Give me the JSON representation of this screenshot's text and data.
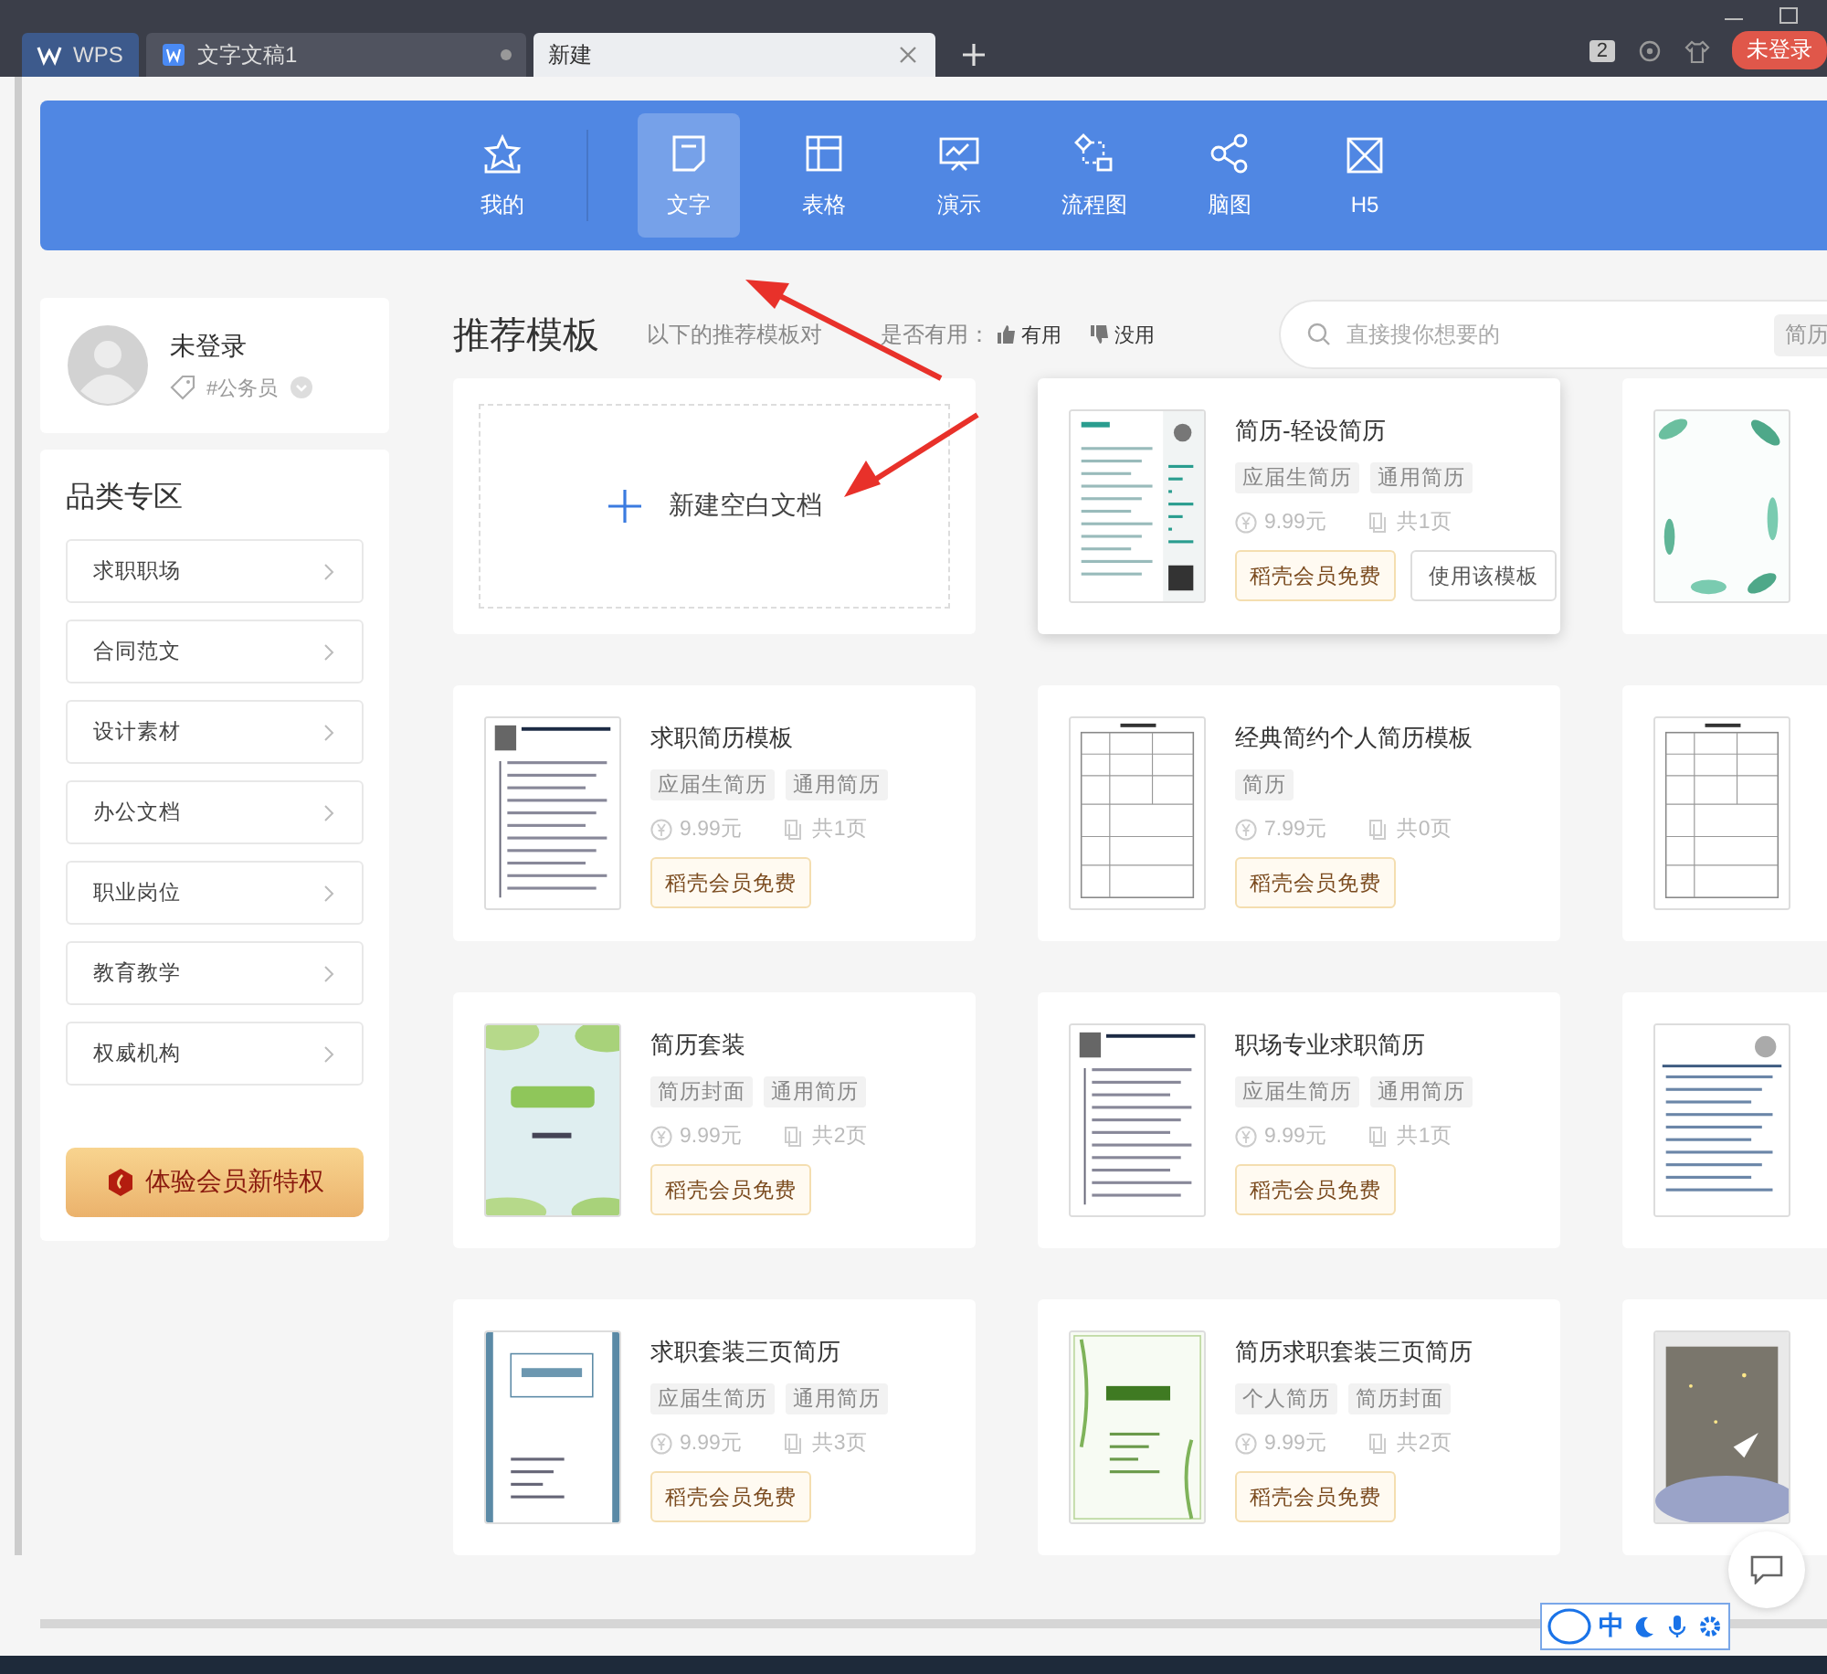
{
  "tabs": [
    {
      "label": "WPS",
      "selected": false,
      "kind": "home"
    },
    {
      "label": "文字文稿1",
      "selected": false,
      "kind": "document"
    },
    {
      "label": "新建",
      "selected": true,
      "kind": "new"
    }
  ],
  "window_count": "2",
  "login_button": "未登录",
  "nav": [
    {
      "label": "我的",
      "selected": false
    },
    {
      "label": "文字",
      "selected": true
    },
    {
      "label": "表格",
      "selected": false
    },
    {
      "label": "演示",
      "selected": false
    },
    {
      "label": "流程图",
      "selected": false
    },
    {
      "label": "脑图",
      "selected": false
    },
    {
      "label": "H5",
      "selected": false
    }
  ],
  "user": {
    "name": "未登录",
    "tag": "#公务员"
  },
  "categories": {
    "title": "品类专区",
    "items": [
      "求职职场",
      "合同范文",
      "设计素材",
      "办公文档",
      "职业岗位",
      "教育教学",
      "权威机构"
    ]
  },
  "vip_button": "体验会员新特权",
  "section_title": "推荐模板",
  "feedback": {
    "prompt_start": "以下的推荐模板对",
    "prompt_end": "是否有用：",
    "yes": "有用",
    "no": "没用"
  },
  "search": {
    "placeholder": "直接搜你想要的",
    "tag": "简历"
  },
  "new_blank": "新建空白文档",
  "templates": [
    {
      "kind": "template",
      "title": "简历-轻设简历",
      "tags": [
        "应届生简历",
        "通用简历"
      ],
      "price": "9.99元",
      "pages": "共1页",
      "member_label": "稻壳会员免费",
      "use_button": "使用该模板",
      "highlighted": true
    },
    {
      "kind": "preview"
    },
    {
      "kind": "template",
      "title": "求职简历模板",
      "tags": [
        "应届生简历",
        "通用简历"
      ],
      "price": "9.99元",
      "pages": "共1页",
      "member_label": "稻壳会员免费",
      "highlighted": false
    },
    {
      "kind": "template",
      "title": "经典简约个人简历模板",
      "tags": [
        "简历"
      ],
      "price": "7.99元",
      "pages": "共0页",
      "member_label": "稻壳会员免费",
      "highlighted": false
    },
    {
      "kind": "preview"
    },
    {
      "kind": "template",
      "title": "简历套装",
      "tags": [
        "简历封面",
        "通用简历"
      ],
      "price": "9.99元",
      "pages": "共2页",
      "member_label": "稻壳会员免费",
      "highlighted": false
    },
    {
      "kind": "template",
      "title": "职场专业求职简历",
      "tags": [
        "应届生简历",
        "通用简历"
      ],
      "price": "9.99元",
      "pages": "共1页",
      "member_label": "稻壳会员免费",
      "highlighted": false
    },
    {
      "kind": "preview"
    },
    {
      "kind": "template",
      "title": "求职套装三页简历",
      "tags": [
        "应届生简历",
        "通用简历"
      ],
      "price": "9.99元",
      "pages": "共3页",
      "member_label": "稻壳会员免费",
      "highlighted": false
    },
    {
      "kind": "template",
      "title": "简历求职套装三页简历",
      "tags": [
        "个人简历",
        "简历封面"
      ],
      "price": "9.99元",
      "pages": "共2页",
      "member_label": "稻壳会员免费",
      "highlighted": false
    },
    {
      "kind": "preview"
    }
  ],
  "ime": {
    "label": "中"
  }
}
